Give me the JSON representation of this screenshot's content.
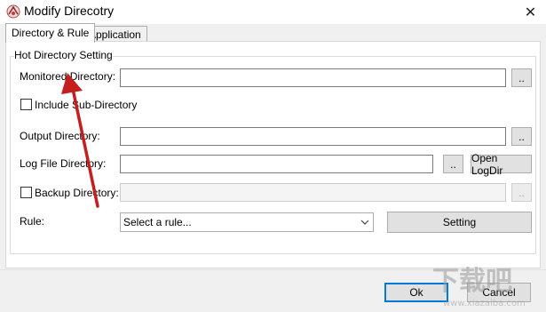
{
  "window": {
    "title": "Modify Direcotry",
    "close_glyph": "✕"
  },
  "tabs": [
    {
      "label": "Directory & Rule"
    },
    {
      "label": "Application"
    }
  ],
  "group": {
    "label": "Hot Directory Setting"
  },
  "fields": {
    "monitored": {
      "label": "Monitored Directory:",
      "value": "",
      "browse": ".."
    },
    "include_sub": {
      "label": "Include Sub-Directory",
      "checked": false
    },
    "output": {
      "label": "Output Directory:",
      "value": "",
      "browse": ".."
    },
    "logfile": {
      "label": "Log File Directory:",
      "value": "",
      "browse": "..",
      "open_label": "Open LogDir"
    },
    "backup": {
      "label": "Backup Directory:",
      "value": "",
      "browse": "..",
      "checked": false
    },
    "rule": {
      "label": "Rule:",
      "selected": "Select a rule...",
      "setting_label": "Setting"
    }
  },
  "footer": {
    "ok_label": "Ok",
    "cancel_label": "Cancel"
  },
  "watermark": {
    "text": "下载吧",
    "url": "www.xiazaiba.com"
  },
  "colors": {
    "arrow": "#c41f1f",
    "accent": "#0078d7"
  },
  "icons": {
    "app": "app-icon",
    "close": "close-icon",
    "chevron": "chevron-down-icon"
  }
}
